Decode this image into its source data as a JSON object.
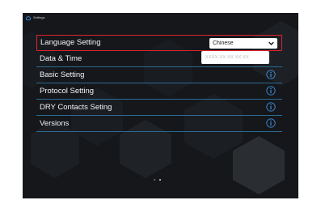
{
  "app": {
    "title": "Settings"
  },
  "menu": {
    "items": [
      {
        "label": "Language Setting",
        "control": "select",
        "value": "Chinese",
        "highlighted": true
      },
      {
        "label": "Data & Time",
        "control": "input",
        "placeholder": "XXXX-XX-XX XX:XX"
      },
      {
        "label": "Basic Setting",
        "control": "info"
      },
      {
        "label": "Protocol Setting",
        "control": "info"
      },
      {
        "label": "DRY Contacts Seting",
        "control": "info"
      },
      {
        "label": "Versions",
        "control": "info"
      }
    ]
  },
  "pagination": {
    "pages": 2,
    "current": 2
  },
  "icons": {
    "home": "home-icon",
    "chevron": "chevron-down-icon",
    "info": "info-icon"
  },
  "colors": {
    "highlight": "#e0232e",
    "accent": "#3b8ad6",
    "divider": "#2d6a93",
    "background": "#141619"
  }
}
